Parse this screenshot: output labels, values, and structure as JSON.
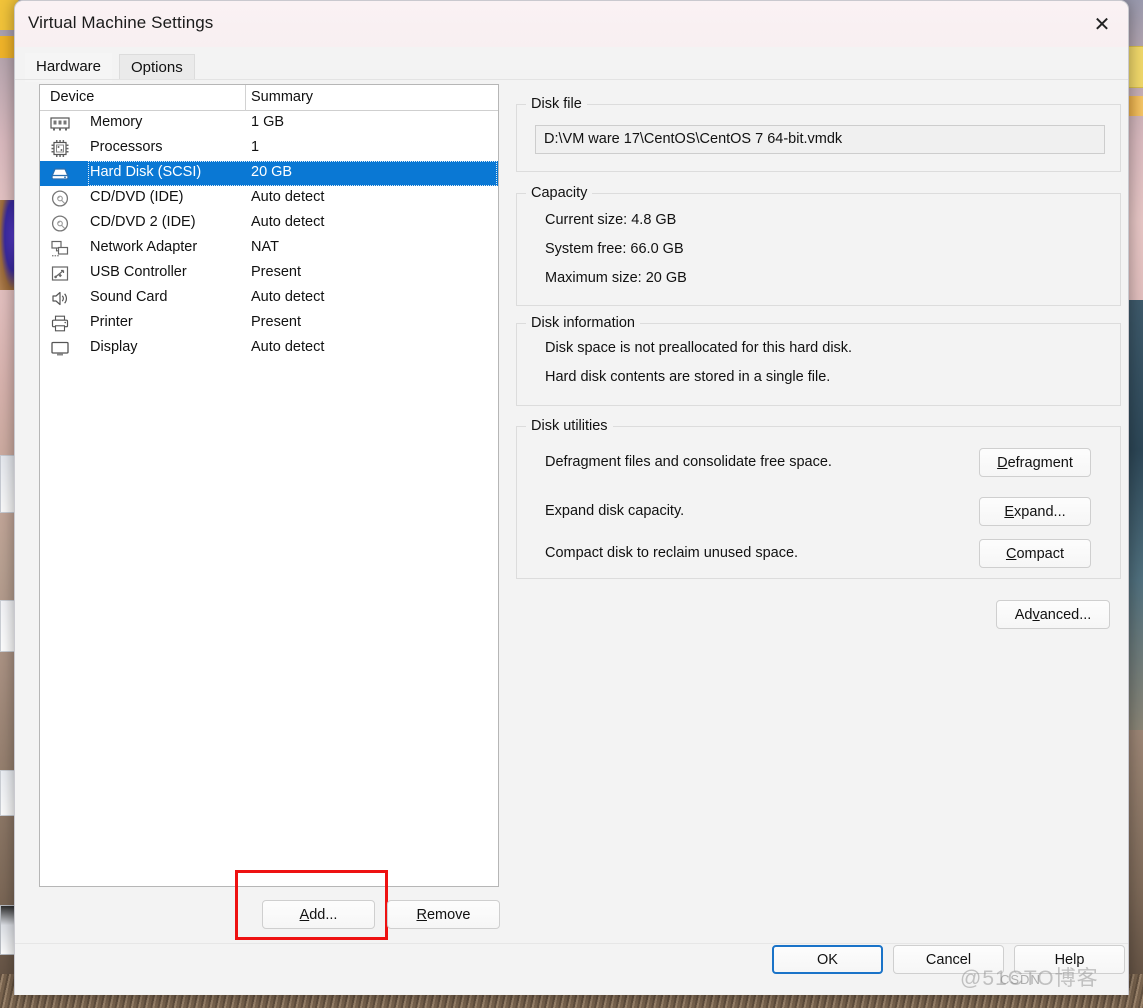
{
  "window": {
    "title": "Virtual Machine Settings",
    "close_icon": "close-icon"
  },
  "tabs": [
    {
      "label": "Hardware",
      "active": true
    },
    {
      "label": "Options",
      "active": false
    }
  ],
  "device_list": {
    "columns": {
      "device": "Device",
      "summary": "Summary"
    },
    "rows": [
      {
        "icon": "memory-icon",
        "device": "Memory",
        "summary": "1 GB",
        "selected": false
      },
      {
        "icon": "processor-icon",
        "device": "Processors",
        "summary": "1",
        "selected": false
      },
      {
        "icon": "hard-disk-icon",
        "device": "Hard Disk (SCSI)",
        "summary": "20 GB",
        "selected": true
      },
      {
        "icon": "cd-dvd-icon",
        "device": "CD/DVD (IDE)",
        "summary": "Auto detect",
        "selected": false
      },
      {
        "icon": "cd-dvd-icon",
        "device": "CD/DVD 2 (IDE)",
        "summary": "Auto detect",
        "selected": false
      },
      {
        "icon": "network-adapter-icon",
        "device": "Network Adapter",
        "summary": "NAT",
        "selected": false
      },
      {
        "icon": "usb-controller-icon",
        "device": "USB Controller",
        "summary": "Present",
        "selected": false
      },
      {
        "icon": "sound-card-icon",
        "device": "Sound Card",
        "summary": "Auto detect",
        "selected": false
      },
      {
        "icon": "printer-icon",
        "device": "Printer",
        "summary": "Present",
        "selected": false
      },
      {
        "icon": "display-icon",
        "device": "Display",
        "summary": "Auto detect",
        "selected": false
      }
    ],
    "add_label": "Add...",
    "remove_label": "Remove"
  },
  "disk_file": {
    "group_title": "Disk file",
    "path": "D:\\VM ware 17\\CentOS\\CentOS 7 64-bit.vmdk"
  },
  "capacity": {
    "group_title": "Capacity",
    "current_size": "Current size: 4.8 GB",
    "system_free": "System free: 66.0 GB",
    "maximum_size": "Maximum size: 20 GB"
  },
  "disk_information": {
    "group_title": "Disk information",
    "line1": "Disk space is not preallocated for this hard disk.",
    "line2": "Hard disk contents are stored in a single file."
  },
  "disk_utilities": {
    "group_title": "Disk utilities",
    "rows": [
      {
        "text": "Defragment files and consolidate free space.",
        "button": "Defragment"
      },
      {
        "text": "Expand disk capacity.",
        "button": "Expand..."
      },
      {
        "text": "Compact disk to reclaim unused space.",
        "button": "Compact"
      }
    ],
    "advanced_label": "Advanced..."
  },
  "footer": {
    "ok": "OK",
    "cancel": "Cancel",
    "help": "Help"
  },
  "watermark": {
    "line1": "@51CTO博客",
    "line2": "CSDN"
  },
  "colors": {
    "selection_blue": "#0a78d4",
    "annotation_red": "#ee1111",
    "default_button_border": "#1a73c8",
    "dialog_bg": "#f3f3f3"
  }
}
